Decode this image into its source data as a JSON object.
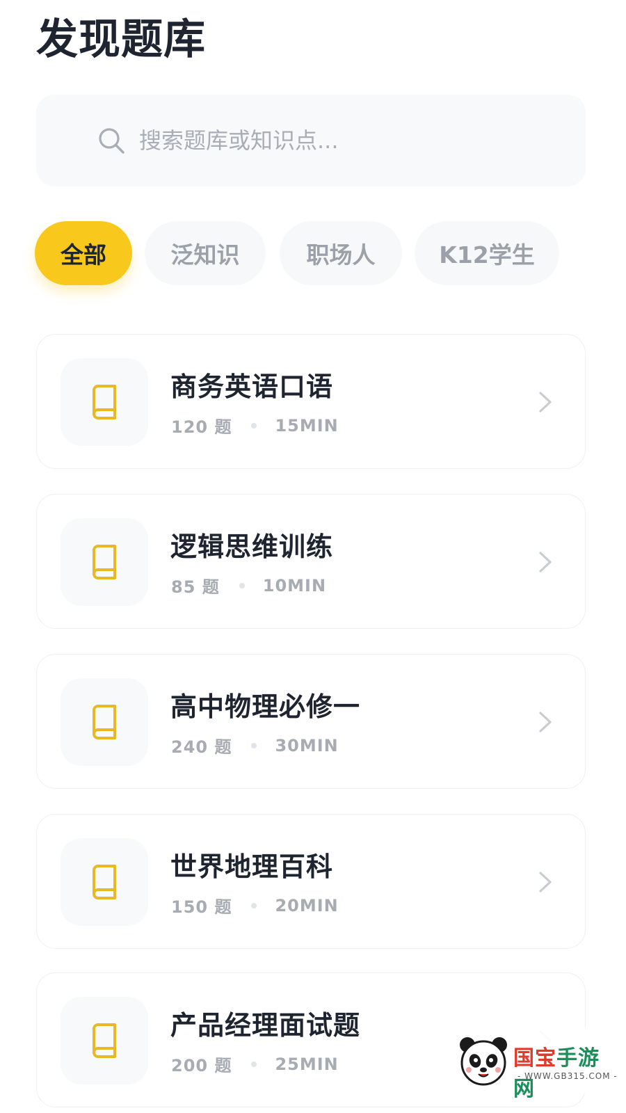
{
  "page": {
    "title": "发现题库"
  },
  "search": {
    "placeholder": "搜索题库或知识点..."
  },
  "filters": [
    {
      "label": "全部",
      "active": true
    },
    {
      "label": "泛知识",
      "active": false
    },
    {
      "label": "职场人",
      "active": false
    },
    {
      "label": "K12学生",
      "active": false
    }
  ],
  "banks": [
    {
      "title": "商务英语口语",
      "count": "120 题",
      "duration": "15MIN"
    },
    {
      "title": "逻辑思维训练",
      "count": "85 题",
      "duration": "10MIN"
    },
    {
      "title": "高中物理必修一",
      "count": "240 题",
      "duration": "30MIN"
    },
    {
      "title": "世界地理百科",
      "count": "150 题",
      "duration": "20MIN"
    },
    {
      "title": "产品经理面试题",
      "count": "200 题",
      "duration": "25MIN"
    }
  ],
  "watermark": {
    "brand_1": "国宝",
    "brand_2": "手游网",
    "url": "- WWW.GB315.COM -"
  },
  "colors": {
    "accent": "#f8c81c",
    "icon": "#e8b924",
    "text": "#1f2530",
    "muted": "#a7abb2"
  }
}
